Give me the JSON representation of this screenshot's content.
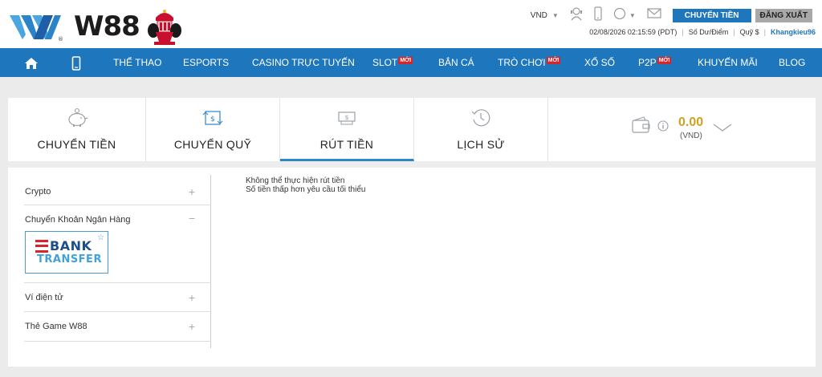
{
  "header": {
    "brand": "W88",
    "currency": "VND",
    "transfer_button": "CHUYỂN TIỀN",
    "logout_button": "ĐĂNG XUẤT",
    "datetime": "02/08/2026 02:15:59 (PDT)",
    "balance_label": "Số Dư/Điểm",
    "fund_label": "Quỹ $",
    "username": "Khangkieu96"
  },
  "nav": {
    "items": [
      {
        "label": "THỂ THAO"
      },
      {
        "label": "ESPORTS"
      },
      {
        "label": "CASINO TRỰC TUYẾN"
      },
      {
        "label": "SLOT",
        "badge": "MỚI"
      },
      {
        "label": "BẮN CÁ"
      },
      {
        "label": "TRÒ CHƠI",
        "badge": "MỚI"
      },
      {
        "label": "XỔ SỐ"
      },
      {
        "label": "P2P",
        "badge": "MỚI"
      },
      {
        "label": "KHUYẾN MÃI"
      },
      {
        "label": "BLOG"
      }
    ]
  },
  "tabs": [
    {
      "label": "CHUYỂN TIỀN",
      "icon": "piggy-bank-icon"
    },
    {
      "label": "CHUYỂN QUỸ",
      "icon": "exchange-icon"
    },
    {
      "label": "RÚT TIỀN",
      "icon": "withdraw-cash-icon",
      "active": true
    },
    {
      "label": "LỊCH SỬ",
      "icon": "history-icon"
    }
  ],
  "balance": {
    "amount": "0.00",
    "currency": "(VND)"
  },
  "sidebar": {
    "items": [
      {
        "label": "Crypto",
        "toggle": "+"
      },
      {
        "label": "Chuyển Khoản Ngân Hàng",
        "toggle": "−"
      },
      {
        "label": "Ví điện tử",
        "toggle": "+"
      },
      {
        "label": "Thẻ Game W88",
        "toggle": "+"
      }
    ],
    "bank_tile": {
      "line1": "BANK",
      "line2": "TRANSFER",
      "star": "☆"
    }
  },
  "message": {
    "line1": "Không thể thực hiện rút tiền",
    "line2": "Số tiền thấp hơn yêu cầu tối thiểu"
  },
  "colors": {
    "brand_blue": "#1e77bd",
    "badge_red": "#d9242b",
    "balance_gold": "#cda221"
  }
}
